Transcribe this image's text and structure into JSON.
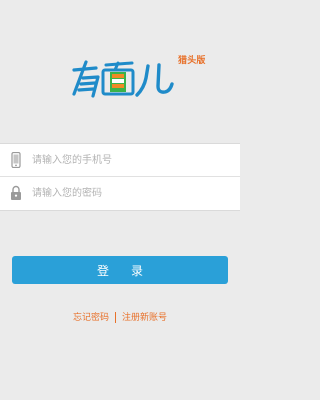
{
  "logo": {
    "badge": "猎头版",
    "icon": "youmianer-logo",
    "colors": {
      "blue": "#1f8bc9",
      "green": "#3ab34a",
      "orange": "#f08a24"
    }
  },
  "form": {
    "phone": {
      "icon": "phone-icon",
      "placeholder": "请输入您的手机号",
      "value": ""
    },
    "password": {
      "icon": "lock-icon",
      "placeholder": "请输入您的密码",
      "value": ""
    }
  },
  "login_button": {
    "label": "登录",
    "color": "#2aa0d8"
  },
  "links": {
    "forgot_password": "忘记密码",
    "separator": "|",
    "register": "注册新账号",
    "color": "#e8712a"
  }
}
